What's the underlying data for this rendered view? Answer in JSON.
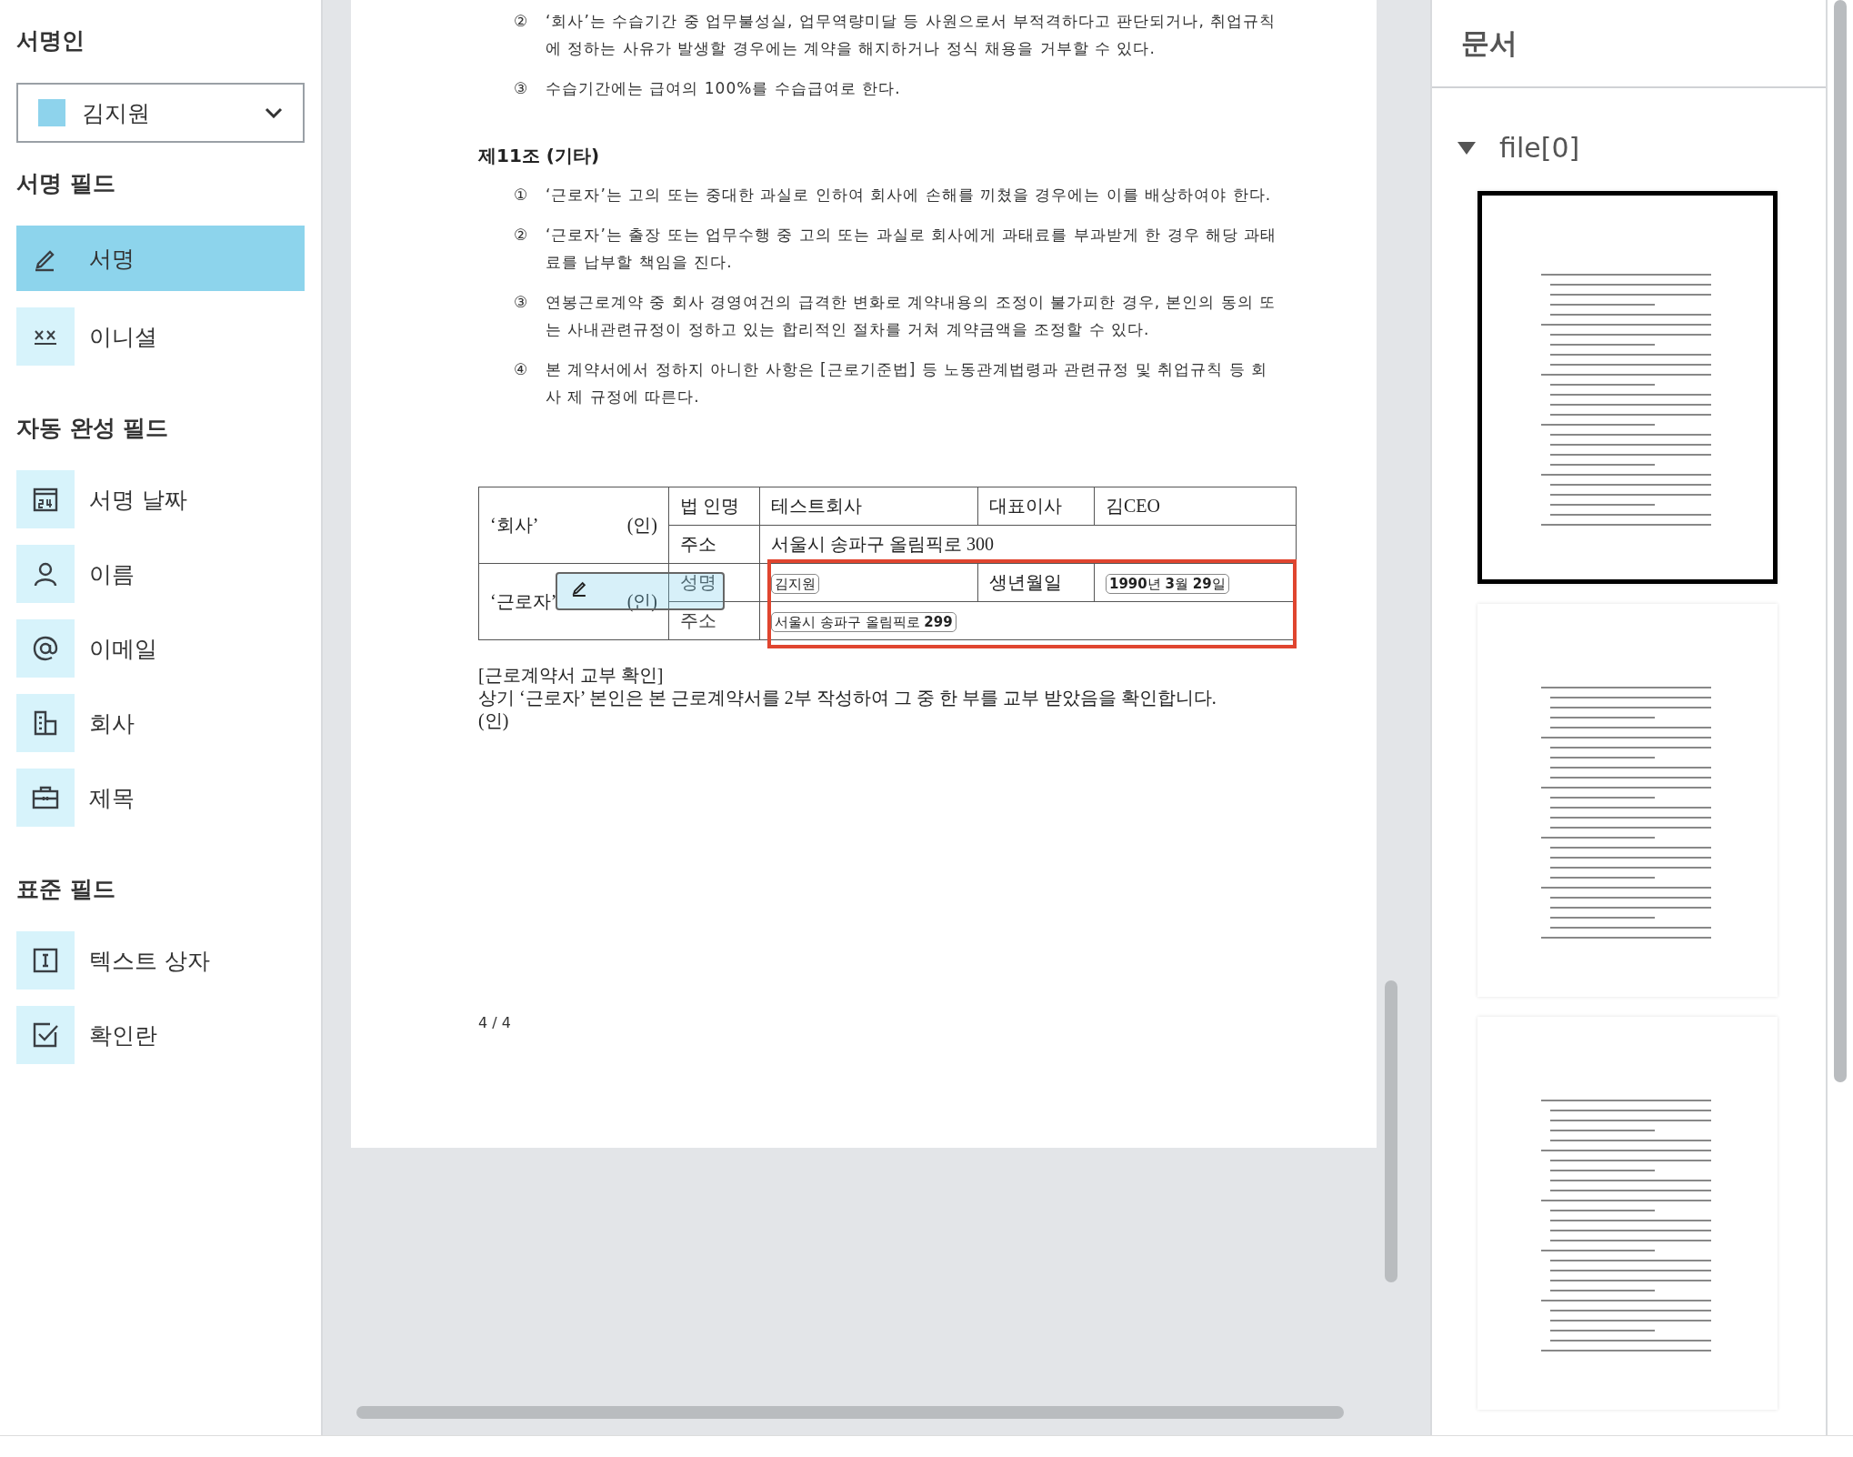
{
  "sidebar": {
    "signer_heading": "서명인",
    "signer": {
      "name": "김지원",
      "color": "#8ed3ec"
    },
    "groups": [
      {
        "heading": "서명 필드",
        "items": [
          {
            "label": "서명",
            "kind": "signature",
            "selected": true
          },
          {
            "label": "이니셜",
            "kind": "initial",
            "selected": false
          }
        ]
      },
      {
        "heading": "자동 완성 필드",
        "items": [
          {
            "label": "서명 날짜",
            "kind": "date",
            "selected": false
          },
          {
            "label": "이름",
            "kind": "person",
            "selected": false
          },
          {
            "label": "이메일",
            "kind": "email",
            "selected": false
          },
          {
            "label": "회사",
            "kind": "company",
            "selected": false
          },
          {
            "label": "제목",
            "kind": "title",
            "selected": false
          }
        ]
      },
      {
        "heading": "표준 필드",
        "items": [
          {
            "label": "텍스트 상자",
            "kind": "text",
            "selected": false
          },
          {
            "label": "확인란",
            "kind": "checkbox",
            "selected": false
          }
        ]
      }
    ]
  },
  "document": {
    "blocks": [
      {
        "kind": "item",
        "number": "②",
        "text": "‘회사’는 수습기간 중 업무불성실, 업무역량미달 등 사원으로서 부적격하다고 판단되거나, 취업규칙에 정하는 사유가 발생할 경우에는 계약을 해지하거나 정식 채용을 거부할 수 있다."
      },
      {
        "kind": "item",
        "number": "③",
        "text": "수습기간에는 급여의 100%를 수습급여로 한다."
      },
      {
        "kind": "heading",
        "text": "제11조 (기타)"
      },
      {
        "kind": "item",
        "number": "①",
        "text": "‘근로자’는 고의 또는 중대한 과실로 인하여 회사에 손해를 끼쳤을 경우에는 이를 배상하여야 한다."
      },
      {
        "kind": "item",
        "number": "②",
        "text": "‘근로자’는 출장 또는 업무수행 중 고의 또는 과실로 회사에게 과태료를 부과받게 한 경우 해당 과태료를 납부할 책임을 진다."
      },
      {
        "kind": "item",
        "number": "③",
        "text": "연봉근로계약 중 회사 경영여건의 급격한 변화로 계약내용의 조정이 불가피한 경우, 본인의 동의 또는 사내관련규정이 정하고 있는 합리적인 절차를 거쳐 계약금액을 조정할 수 있다."
      },
      {
        "kind": "item",
        "number": "④",
        "text": "본 계약서에서 정하지 아니한 사항은 [근로기준법] 등 노동관계법령과 관련규정 및 취업규칙 등 회사 제 규정에 따른다."
      }
    ],
    "table": {
      "company_label": "‘회사’",
      "company_seal": "(인)",
      "corp_name_label": "법 인명",
      "corp_name": "테스트회사",
      "ceo_label": "대표이사",
      "ceo": "김CEO",
      "company_address_label": "주소",
      "company_address": "서울시 송파구 올림픽로 300",
      "worker_label": "‘근로자’",
      "worker_seal": "(인)",
      "worker_name_label": "성명",
      "worker_name": "김지원",
      "birth_label": "생년월일",
      "birth": "**1990**년 **3**월 **29**일",
      "worker_address_label": "주소",
      "worker_address": "서울시 송파구 올림픽로 **299**"
    },
    "confirm": [
      "[근로계약서 교부 확인]",
      "상기 ‘근로자’ 본인은 본 근로계약서를 2부 작성하여 그 중 한 부를 교부 받았음을 확인합니다.",
      "(인)"
    ],
    "page_number": "4 / 4"
  },
  "documents_panel": {
    "title": "문서",
    "file": {
      "name": "file[0]",
      "expanded": true
    },
    "thumbnails": [
      {
        "selected": true
      },
      {
        "selected": false
      },
      {
        "selected": false
      }
    ]
  }
}
